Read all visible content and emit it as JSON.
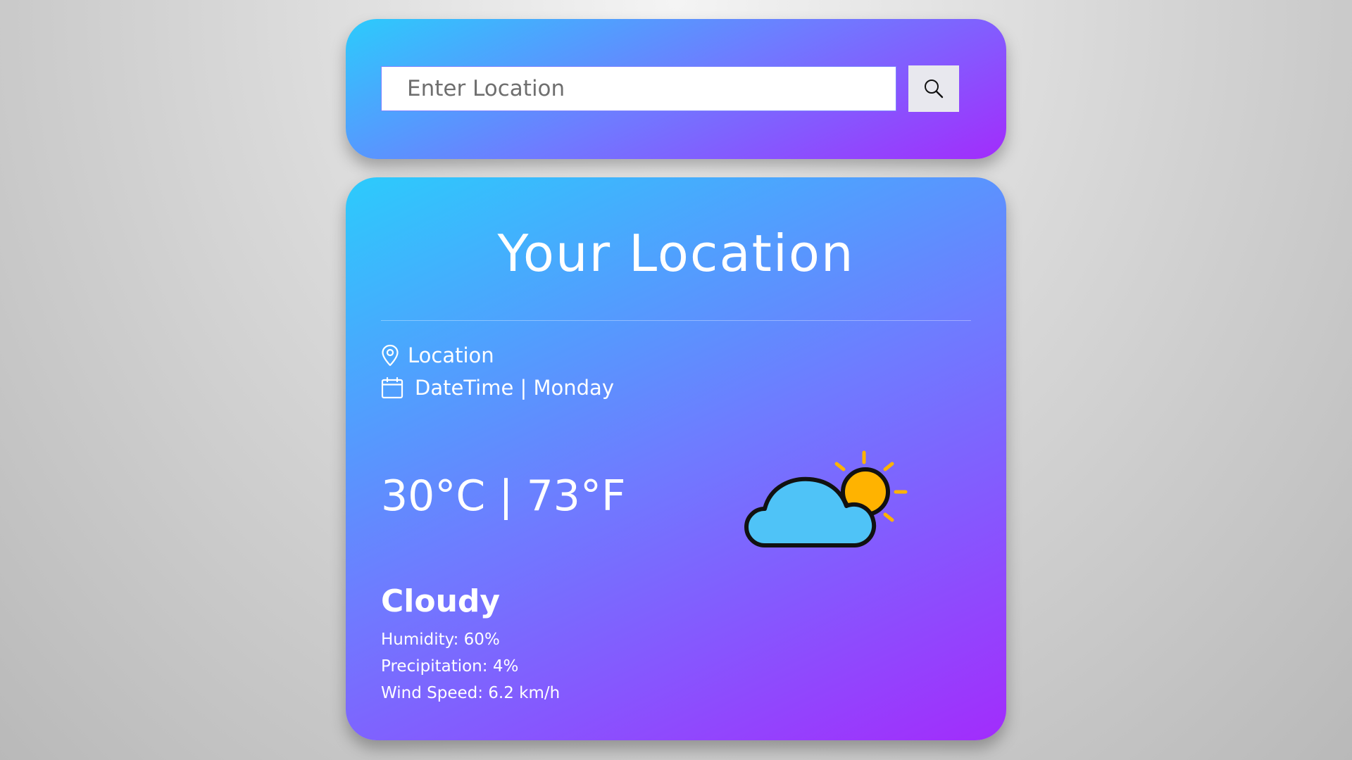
{
  "search": {
    "placeholder": "Enter Location",
    "value": "",
    "button_icon": "search-icon"
  },
  "weather": {
    "title": "Your Location",
    "location": "Location",
    "datetime": "DateTime | Monday",
    "temperature": "30°C | 73°F",
    "condition": "Cloudy",
    "condition_icon": "partly-cloudy-icon",
    "humidity": "Humidity: 60%",
    "precipitation": "Precipitation: 4%",
    "wind_speed": "Wind Speed: 6.2 km/h"
  },
  "colors": {
    "gradient_start": "#2ccbfc",
    "gradient_mid": "#6f7bff",
    "gradient_end": "#a22cfc",
    "cloud": "#4fc3f7",
    "sun": "#ffb300",
    "text": "#ffffff"
  }
}
